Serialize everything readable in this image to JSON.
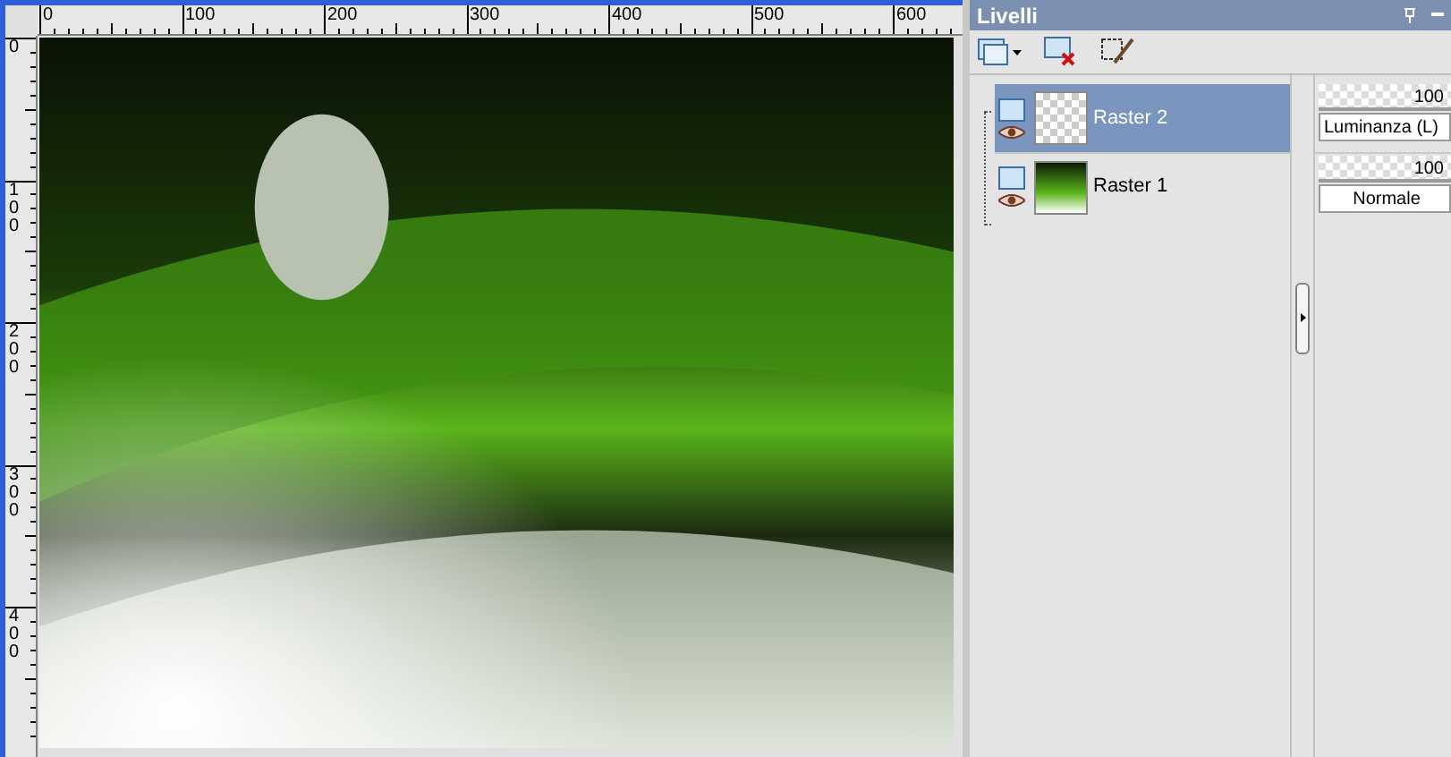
{
  "rulers": {
    "horizontal": [
      "0",
      "100",
      "200",
      "300",
      "400",
      "500",
      "600"
    ],
    "vertical": [
      "0",
      "100",
      "200",
      "300",
      "400"
    ]
  },
  "panel": {
    "title": "Livelli"
  },
  "layers": [
    {
      "name": "Raster 2",
      "selected": true,
      "visible": true,
      "opacity": "100",
      "level": 1,
      "blend_mode": "Luminanza (L)"
    },
    {
      "name": "Raster 1",
      "selected": false,
      "visible": true,
      "opacity": "100",
      "level": 1,
      "blend_mode": "Normale"
    }
  ]
}
